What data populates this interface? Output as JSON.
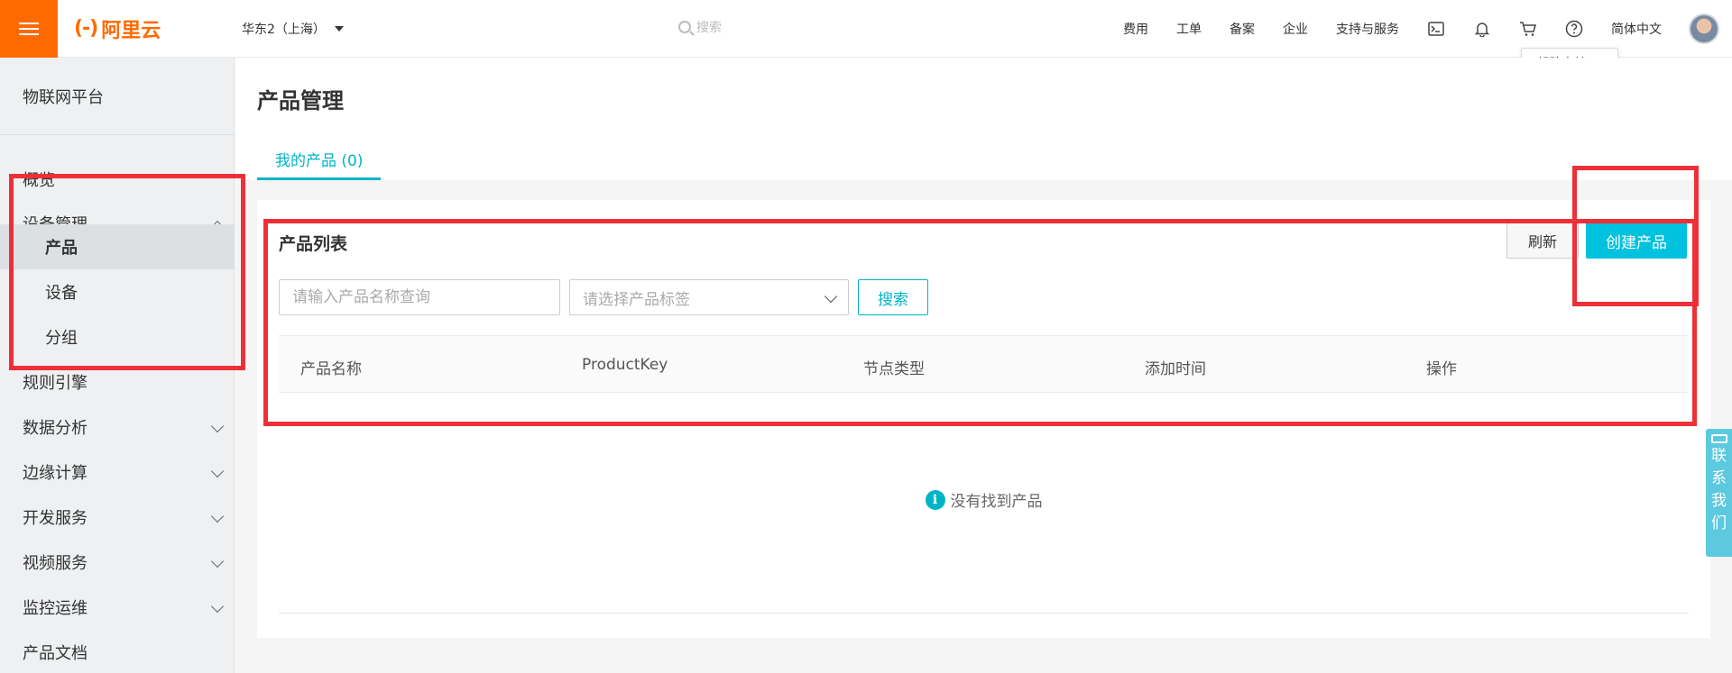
{
  "topbar": {
    "logo_mark": "(-)",
    "logo_text": "阿里云",
    "region": "华东2（上海）",
    "search_placeholder": "搜索",
    "nav": [
      "费用",
      "工单",
      "备案",
      "企业",
      "支持与服务"
    ],
    "lang": "简体中文",
    "icons": [
      "terminal-icon",
      "bell-icon",
      "cart-icon",
      "help-icon"
    ],
    "accent_color": "#ff6a00"
  },
  "help_tip": {
    "label": "帮助文档",
    "close": "✕"
  },
  "sidebar": {
    "platform": "物联网平台",
    "items": [
      {
        "label": "概览"
      },
      {
        "label": "设备管理",
        "expanded": true
      },
      {
        "label": "产品",
        "active": true
      },
      {
        "label": "设备"
      },
      {
        "label": "分组"
      },
      {
        "label": "规则引擎"
      },
      {
        "label": "数据分析"
      },
      {
        "label": "边缘计算"
      },
      {
        "label": "开发服务"
      },
      {
        "label": "视频服务"
      },
      {
        "label": "监控运维"
      },
      {
        "label": "产品文档"
      }
    ]
  },
  "main": {
    "title": "产品管理",
    "tab": "我的产品 (0)",
    "card": {
      "title": "产品列表",
      "refresh_label": "刷新",
      "create_label": "创建产品",
      "name_placeholder": "请输入产品名称查询",
      "tag_placeholder": "请选择产品标签",
      "search_label": "搜索",
      "columns": [
        "产品名称",
        "ProductKey",
        "节点类型",
        "添加时间",
        "操作"
      ],
      "empty_text": "没有找到产品",
      "primary_color": "#00c1de"
    }
  },
  "contact": {
    "chars": [
      "联",
      "系",
      "我",
      "们"
    ]
  }
}
